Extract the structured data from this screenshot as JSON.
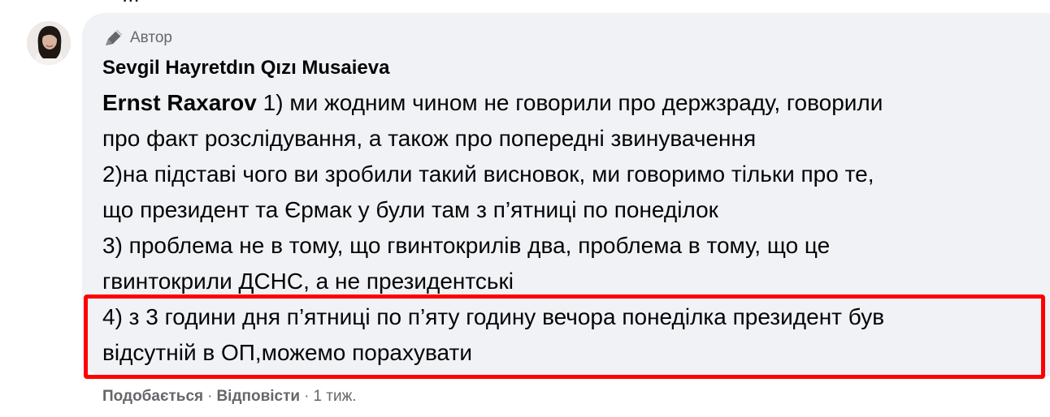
{
  "post": {
    "top_cut_text": "..."
  },
  "comment": {
    "author_badge": "Автор",
    "author_name": "Sevgil Hayretdın Qızı Musaieva",
    "mention": "Ernst Raxarov",
    "line_1_rest": "1) ми жодним чином не говорили про держзраду, говорили",
    "line_2": "про факт розслідування, а також про попередні звинувачення",
    "line_3": "2)на підставі чого ви зробили такий висновок, ми говоримо тільки про те,",
    "line_4": "що президент та Єрмак у були там з п’ятниці по понеділок",
    "line_5": "3) проблема не в тому, що гвинтокрилів два, проблема в тому, що це",
    "line_6": "гвинтокрили ДСНС, а не президентські",
    "line_7": "4) з 3 години дня п’ятниці по п’яту годину вечора понеділка президент був",
    "line_8": "відсутній в ОП,можемо порахувати"
  },
  "actions": {
    "like": "Подобається",
    "reply": "Відповісти",
    "time": "1 тиж.",
    "separator": "·"
  },
  "colors": {
    "bubble_bg": "#f0f2f5",
    "meta_text": "#65676b",
    "highlight": "#ff0000"
  },
  "icons": {
    "author_badge_icon": "pencil-microphone-icon"
  }
}
